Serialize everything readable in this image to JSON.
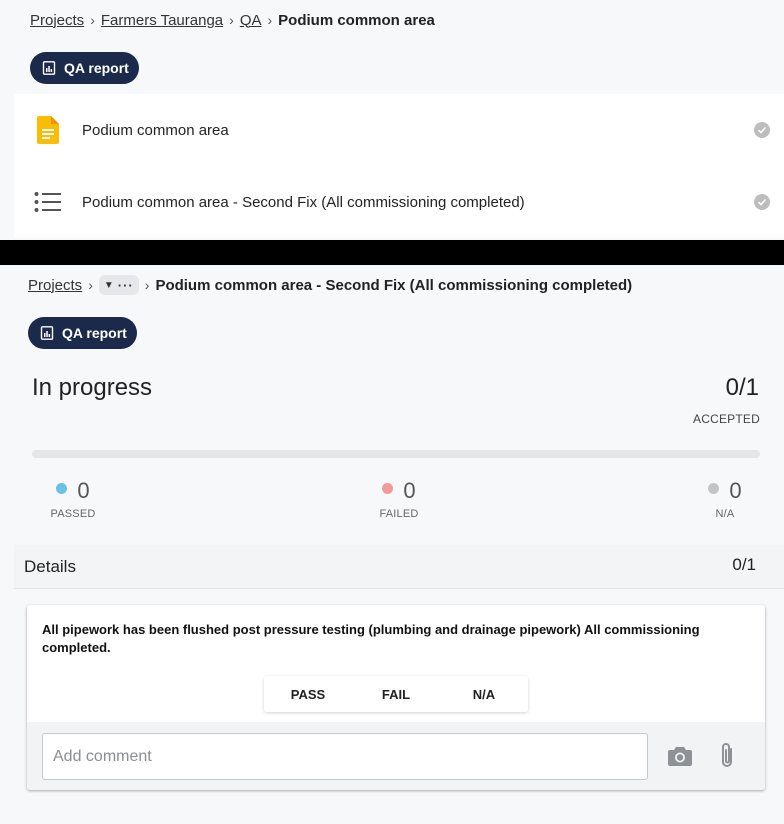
{
  "top": {
    "breadcrumb": [
      {
        "label": "Projects"
      },
      {
        "label": "Farmers Tauranga"
      },
      {
        "label": "QA"
      }
    ],
    "breadcrumb_current": "Podium common area",
    "qa_report_label": "QA report",
    "items": [
      {
        "label": "Podium common area",
        "icon": "document-icon"
      },
      {
        "label": "Podium common area - Second Fix (All commissioning completed)",
        "icon": "list-icon"
      }
    ]
  },
  "bottom": {
    "breadcrumb_root": "Projects",
    "breadcrumb_current": "Podium common area - Second Fix (All commissioning completed)",
    "qa_report_label": "QA report",
    "status": "In progress",
    "accepted_ratio": "0/1",
    "accepted_label": "ACCEPTED",
    "progress_fraction": 0,
    "stats": [
      {
        "count": "0",
        "label": "PASSED",
        "color": "#6ac2e4"
      },
      {
        "count": "0",
        "label": "FAILED",
        "color": "#f19a9a"
      },
      {
        "count": "0",
        "label": "N/A",
        "color": "#c4c4c4"
      }
    ],
    "details_label": "Details",
    "details_count": "0/1",
    "question": "All pipework has been flushed post pressure testing (plumbing and drainage pipework) All commissioning completed.",
    "options": [
      "PASS",
      "FAIL",
      "N/A"
    ],
    "comment_placeholder": "Add comment"
  },
  "colors": {
    "qa_button_bg": "#1b2a4a",
    "document_icon": "#fbbc04",
    "progress_track": "#e5e6e8"
  }
}
